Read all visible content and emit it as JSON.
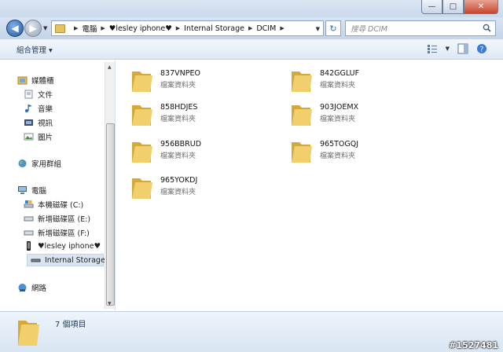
{
  "window": {
    "minimize_glyph": "—",
    "maximize_glyph": "□",
    "close_glyph": "✕"
  },
  "address_bar": {
    "breadcrumbs": [
      "電腦",
      "♥lesley iphone♥",
      "Internal Storage",
      "DCIM"
    ],
    "refresh_glyph": "↻"
  },
  "search": {
    "placeholder": "搜尋 DCIM"
  },
  "toolbar": {
    "organize_label": "組合管理 ▾"
  },
  "sidebar": {
    "favorites": "媒體櫃",
    "libraries": [
      "文件",
      "音樂",
      "視訊",
      "圖片"
    ],
    "homegroup": "家用群組",
    "computer": "電腦",
    "drives": [
      "本機磁碟 (C:)",
      "新增磁碟區 (E:)",
      "新增磁碟區 (F:)",
      "♥lesley iphone♥",
      "Internal Storage"
    ],
    "network": "網路"
  },
  "folders": [
    {
      "name": "837VNPEO",
      "type": "檔案資料夾"
    },
    {
      "name": "842GGLUF",
      "type": "檔案資料夾"
    },
    {
      "name": "858HDJES",
      "type": "檔案資料夾"
    },
    {
      "name": "903JOEMX",
      "type": "檔案資料夾"
    },
    {
      "name": "956BBRUD",
      "type": "檔案資料夾"
    },
    {
      "name": "965TOGQJ",
      "type": "檔案資料夾"
    },
    {
      "name": "965YOKDJ",
      "type": "檔案資料夾"
    }
  ],
  "status": {
    "item_count": "7 個項目"
  },
  "watermark": "#1527481",
  "colors": {
    "folder": "#f0cf6c",
    "folder_dark": "#d4a93a",
    "accent": "#1e395b"
  }
}
